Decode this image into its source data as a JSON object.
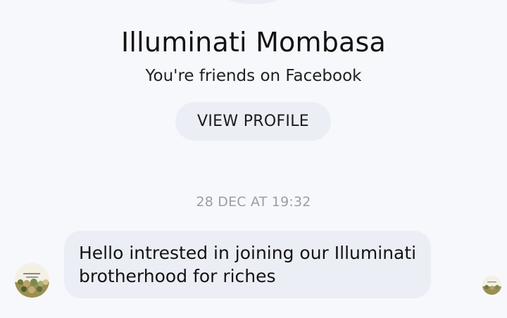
{
  "conversation": {
    "contact_name": "Illuminati Mombasa",
    "relationship": "You're friends on Facebook",
    "view_profile_label": "VIEW PROFILE",
    "timestamp": "28 DEC AT 19:32"
  },
  "messages": [
    {
      "text": "Hello intrested in joining our Illuminati brotherhood for riches",
      "avatar_icon": "group-photo-avatar"
    }
  ],
  "seen_indicator_icon": "seen-avatar",
  "colors": {
    "background": "#f7f8fc",
    "bubble": "#eceef5",
    "button": "#eceef6",
    "timestamp": "#9a9da6",
    "text": "#121212"
  }
}
